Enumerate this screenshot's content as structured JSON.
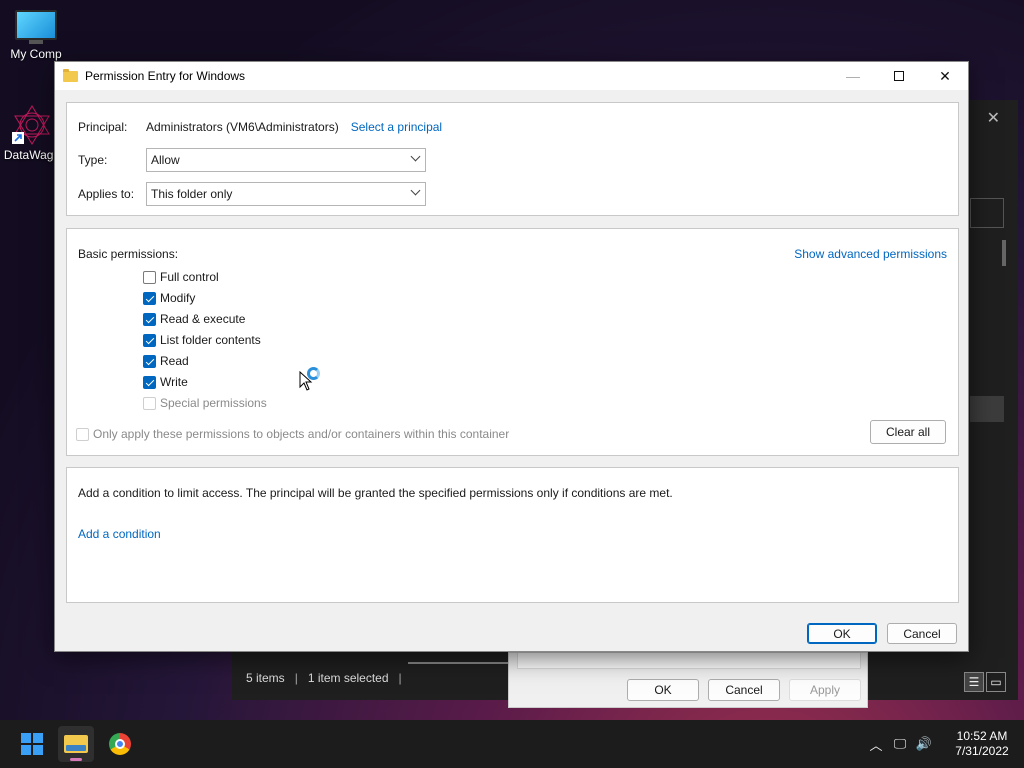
{
  "desktop": {
    "icons": [
      {
        "label": "My Comp"
      },
      {
        "label": "DataWage"
      }
    ]
  },
  "dialog": {
    "title": "Permission Entry for Windows",
    "principal_label": "Principal:",
    "principal_value": "Administrators (VM6\\Administrators)",
    "select_principal_link": "Select a principal",
    "type_label": "Type:",
    "type_value": "Allow",
    "applies_label": "Applies to:",
    "applies_value": "This folder only",
    "basic_permissions_label": "Basic permissions:",
    "show_advanced_link": "Show advanced permissions",
    "permissions": [
      {
        "label": "Full control",
        "checked": false,
        "disabled": false
      },
      {
        "label": "Modify",
        "checked": true,
        "disabled": false
      },
      {
        "label": "Read & execute",
        "checked": true,
        "disabled": false
      },
      {
        "label": "List folder contents",
        "checked": true,
        "disabled": false
      },
      {
        "label": "Read",
        "checked": true,
        "disabled": false
      },
      {
        "label": "Write",
        "checked": true,
        "disabled": false
      },
      {
        "label": "Special permissions",
        "checked": false,
        "disabled": true
      }
    ],
    "only_apply_label": "Only apply these permissions to objects and/or containers within this container",
    "clear_all_label": "Clear all",
    "condition_text": "Add a condition to limit access. The principal will be granted the specified permissions only if conditions are met.",
    "add_condition_link": "Add a condition",
    "ok_label": "OK",
    "cancel_label": "Cancel"
  },
  "explorer": {
    "items_count": "5 items",
    "selected_count": "1 item selected"
  },
  "properties": {
    "ok_label": "OK",
    "cancel_label": "Cancel",
    "apply_label": "Apply"
  },
  "taskbar": {
    "time": "10:52 AM",
    "date": "7/31/2022"
  },
  "colors": {
    "accent": "#0067c0",
    "link": "#0067c0"
  }
}
